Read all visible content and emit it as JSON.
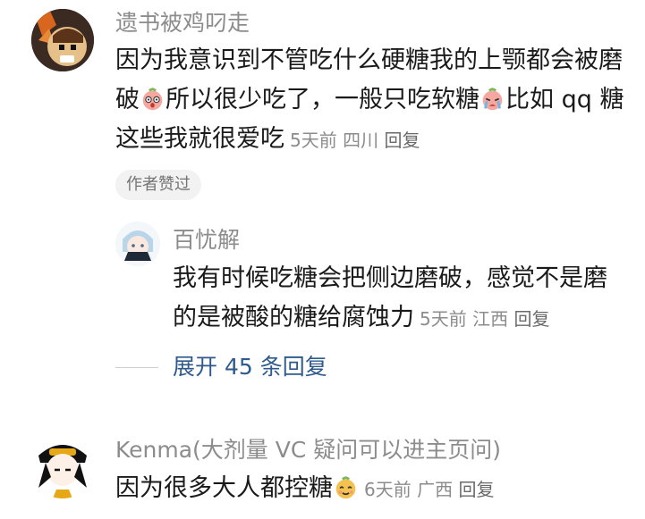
{
  "comments": [
    {
      "username": "遗书被鸡叼走",
      "lines": [
        "因为我意识到不管吃什么硬糖我的上颚都会被磨",
        "破",
        "所以很少吃了，一般只吃软糖",
        "比如 qq 糖",
        "这些我就很爱吃"
      ],
      "time": "5天前",
      "location": "四川",
      "reply_label": "回复",
      "author_like_badge": "作者赞过",
      "emojis": [
        "shocked-emoji-icon",
        "crying-emoji-icon"
      ]
    },
    {
      "username": "百忧解",
      "lines": [
        "我有时候吃糖会把侧边磨破，感觉不是磨",
        "的是被酸的糖给腐蚀力"
      ],
      "time": "5天前",
      "location": "江西",
      "reply_label": "回复"
    },
    {
      "username": "Kenma(大剂量 VC 疑问可以进主页问)",
      "lines": [
        "因为很多大人都控糖"
      ],
      "time": "6天前",
      "location": "广西",
      "reply_label": "回复",
      "emojis": [
        "smug-emoji-icon"
      ]
    }
  ],
  "expand_replies_label": "展开 45 条回复",
  "colors": {
    "username": "#8c8c8c",
    "text": "#1a1a1a",
    "link": "#2e5a8c",
    "badge_bg": "#f2f2f2"
  }
}
